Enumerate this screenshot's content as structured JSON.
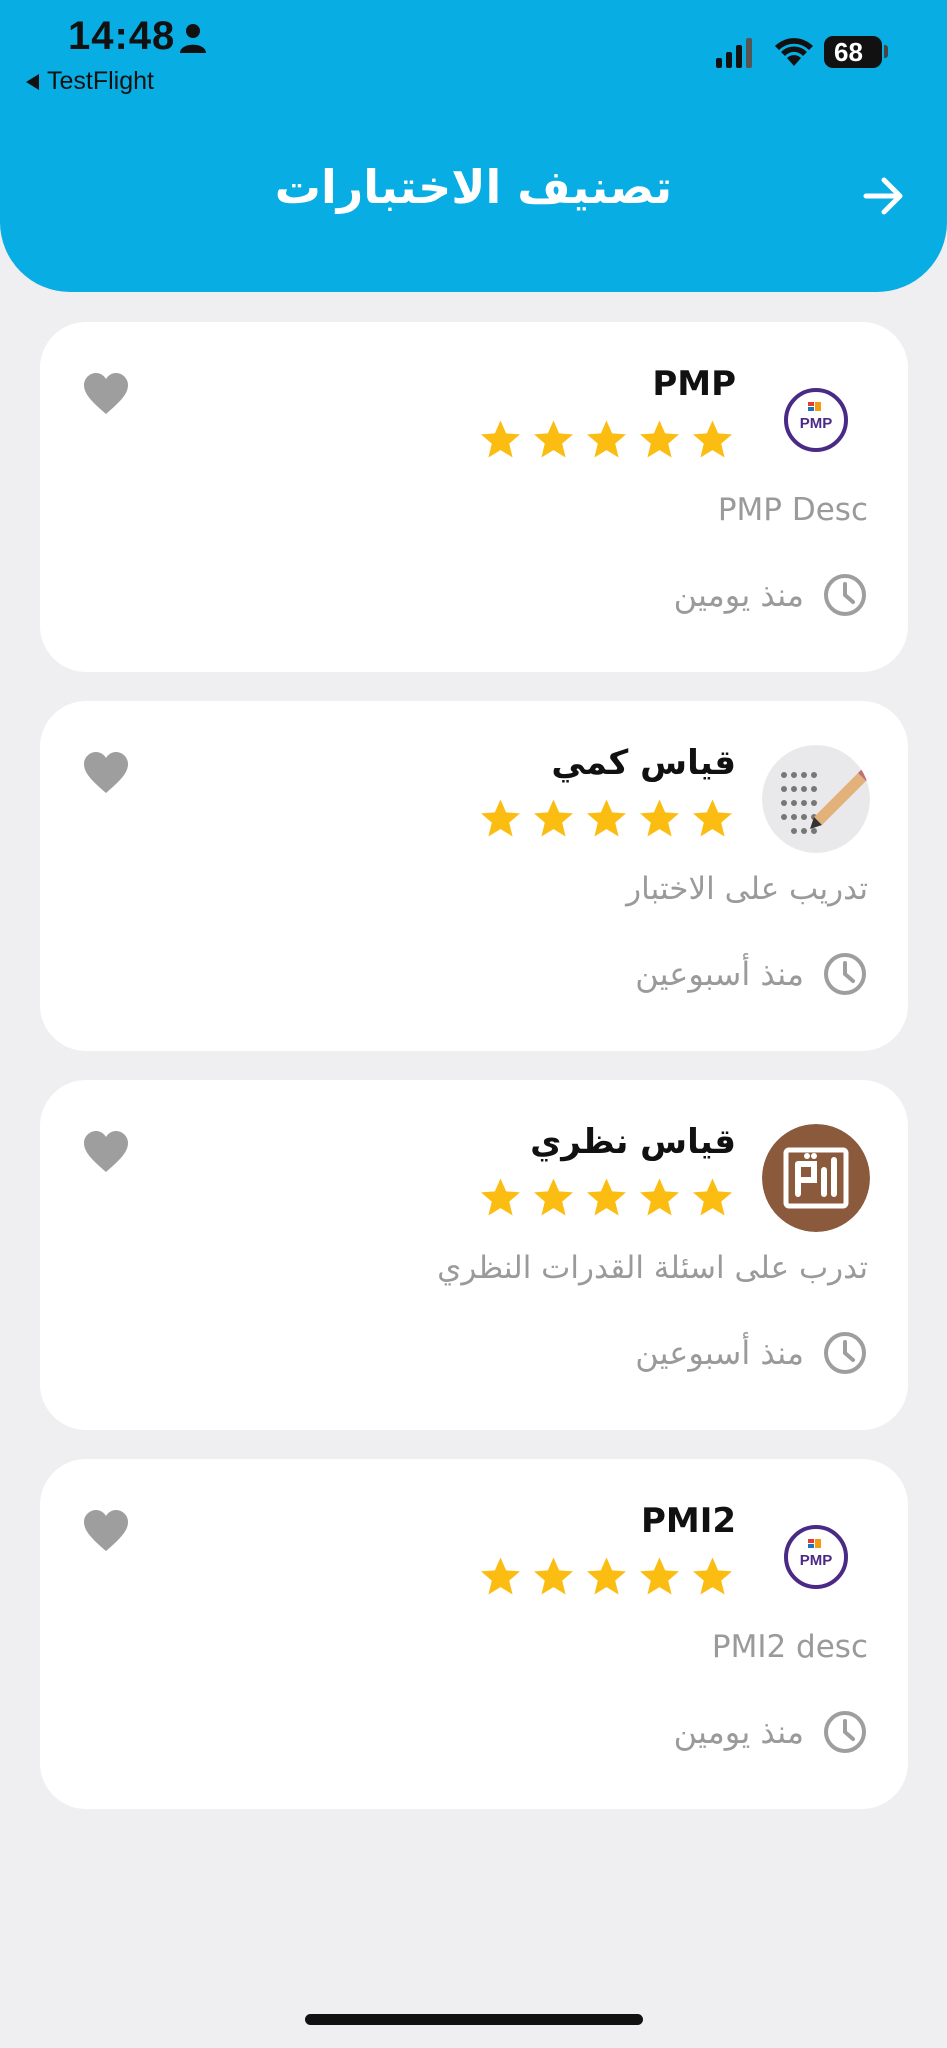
{
  "status_bar": {
    "time": "14:48",
    "back_app": "TestFlight",
    "battery": "68"
  },
  "header": {
    "title": "تصنيف الاختبارات"
  },
  "colors": {
    "header_bg": "#07ade3",
    "star": "#fbbd12",
    "heart": "#9e9e9e",
    "muted_text": "#9a9a9a"
  },
  "cards": [
    {
      "title": "PMP",
      "rating": 5,
      "description": "PMP Desc",
      "time_ago": "منذ يومين",
      "avatar": "pmp-logo"
    },
    {
      "title": "قياس كمي",
      "rating": 5,
      "description": "تدريب على الاختبار",
      "time_ago": "منذ أسبوعين",
      "avatar": "answer-sheet-image"
    },
    {
      "title": "قياس نظري",
      "rating": 5,
      "description": "تدرب على اسئلة القدرات النظري",
      "time_ago": "منذ أسبوعين",
      "avatar": "qiyas-logo"
    },
    {
      "title": "PMI2",
      "rating": 5,
      "description": "PMI2 desc",
      "time_ago": "منذ يومين",
      "avatar": "pmp-logo"
    }
  ]
}
